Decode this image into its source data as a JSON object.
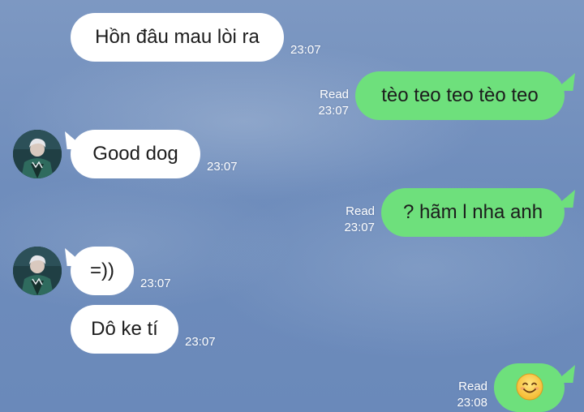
{
  "messages": [
    {
      "side": "in",
      "text": "Hồn đâu mau lòi ra",
      "time": "23:07"
    },
    {
      "side": "out",
      "text": "tèo teo teo tèo teo",
      "status": "Read",
      "time": "23:07"
    },
    {
      "side": "in",
      "text": "Good dog",
      "time": "23:07"
    },
    {
      "side": "out",
      "text": "? hãm l nha anh",
      "status": "Read",
      "time": "23:07"
    },
    {
      "side": "in",
      "text": "=))",
      "time": "23:07"
    },
    {
      "side": "in",
      "text": "Dô ke tí",
      "time": "23:07"
    },
    {
      "side": "out",
      "emoji": "smiling-face-emoji",
      "status": "Read",
      "time": "23:08"
    }
  ],
  "colors": {
    "incoming_bubble": "#ffffff",
    "outgoing_bubble": "#6ee07c",
    "background": "#6f8dbc"
  }
}
